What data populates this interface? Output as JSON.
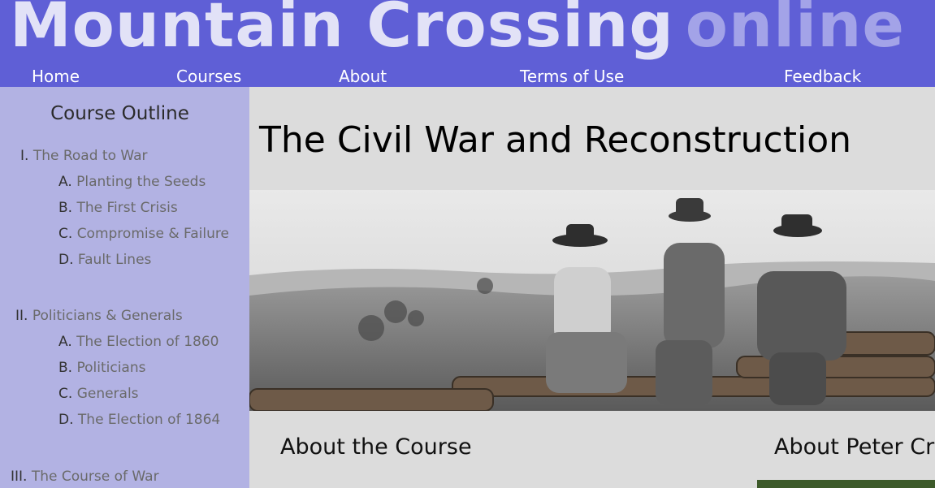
{
  "brand": {
    "main": "Mountain Crossing",
    "sub": "online"
  },
  "nav": {
    "items": [
      "Home",
      "Courses",
      "About",
      "Terms of Use",
      "Feedback"
    ]
  },
  "sidebar": {
    "title": "Course Outline",
    "sections": [
      {
        "num": "I.",
        "label": "The Road to War",
        "items": [
          {
            "num": "A.",
            "label": "Planting the Seeds"
          },
          {
            "num": "B.",
            "label": "The First Crisis"
          },
          {
            "num": "C.",
            "label": "Compromise & Failure"
          },
          {
            "num": "D.",
            "label": "Fault Lines"
          }
        ]
      },
      {
        "num": "II.",
        "label": "Politicians & Generals",
        "items": [
          {
            "num": "A.",
            "label": "The Election of 1860"
          },
          {
            "num": "B.",
            "label": "Politicians"
          },
          {
            "num": "C.",
            "label": "Generals"
          },
          {
            "num": "D.",
            "label": "The Election of 1864"
          }
        ]
      },
      {
        "num": "III.",
        "label": "The Course of War",
        "items": []
      }
    ]
  },
  "main": {
    "title": "The Civil War and Reconstruction",
    "about_course": "About the Course",
    "about_instructor": "About Peter Cra"
  },
  "colors": {
    "header": "#5f5fd6",
    "sidebar": "#b2b2e3",
    "content": "#dcdcdc"
  }
}
